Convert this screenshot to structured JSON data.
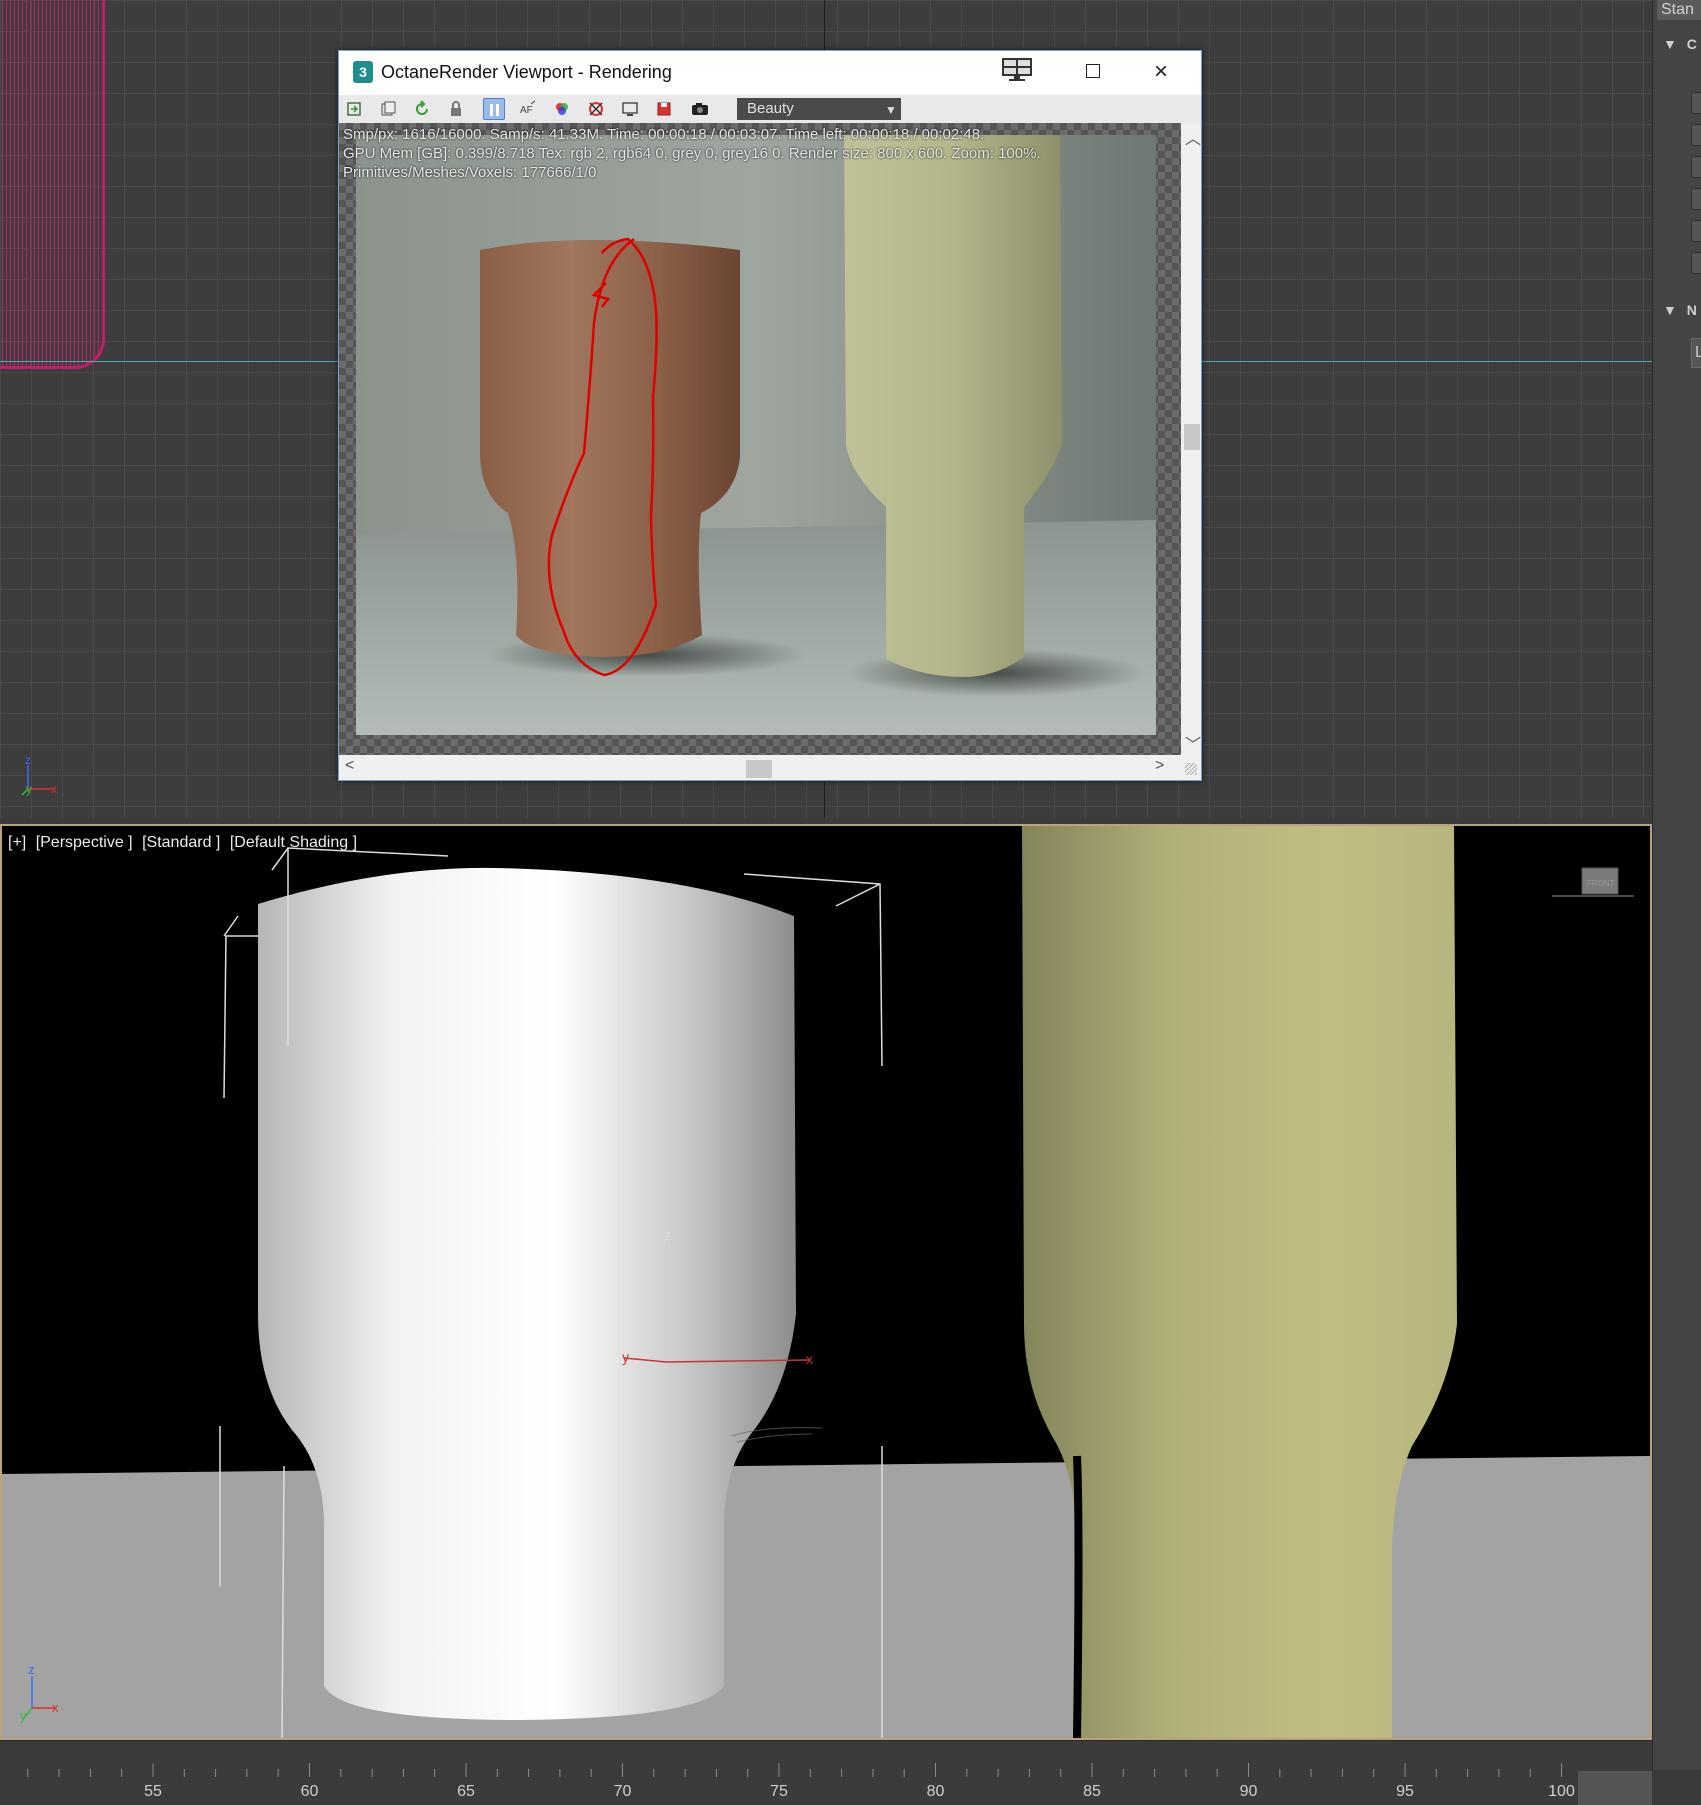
{
  "octane_window": {
    "title": "OctaneRender Viewport - Rendering",
    "app_icon_glyph": "3",
    "render_pass": "Beauty",
    "stats": {
      "line1": "Smp/px: 1616/16000.  Samp/s: 41.33M.  Time: 00:00:18 / 00:03:07.  Time left: 00:00:18 / 00:02:48.",
      "line2": "GPU Mem [GB]: 0.399/8.718  Tex: rgb 2, rgb64 0, grey 0, grey16 0.  Render size: 800 x 600.  Zoom: 100%.",
      "line3": "Primitives/Meshes/Voxels: 177666/1/0"
    },
    "toolbar_icons": [
      "export-icon",
      "copy-icon",
      "refresh-icon",
      "lock-icon",
      "pause-icon",
      "af-icon",
      "color-icon",
      "region-icon",
      "display-icon",
      "save-icon",
      "camera-icon"
    ],
    "colors": {
      "titlebar": "#ffffff",
      "border": "#6ea3d9",
      "pause_active": "#9bbbe8",
      "annotation": "#e00000"
    }
  },
  "bottom_viewport": {
    "labels": [
      "[+]",
      "[Perspective ]",
      "[Standard ]",
      "[Default Shading ]"
    ],
    "gizmo": {
      "z": "z",
      "y": "y",
      "x": "x"
    },
    "axis_tripod": {
      "z": "z",
      "y": "y",
      "x": "x"
    },
    "viewcube_label": "FRONT",
    "colors": {
      "border": "#b8a37a",
      "background": "#000000",
      "floor": "#a3a3a3"
    }
  },
  "top_viewport": {
    "axis_tripod": {
      "z": "z",
      "y": "y",
      "x": "x"
    },
    "colors": {
      "wireframe": "#c71f6c",
      "grid": "#4a4a4a",
      "axis_line": "#4fa8b5"
    }
  },
  "command_panel": {
    "tab_text": "Stan",
    "rollouts": [
      {
        "label": "C"
      },
      {
        "label": "N"
      }
    ],
    "field_text": "L"
  },
  "timeline": {
    "ticks": [
      "55",
      "60",
      "65",
      "70",
      "75",
      "80",
      "85",
      "90",
      "95",
      "100"
    ]
  }
}
